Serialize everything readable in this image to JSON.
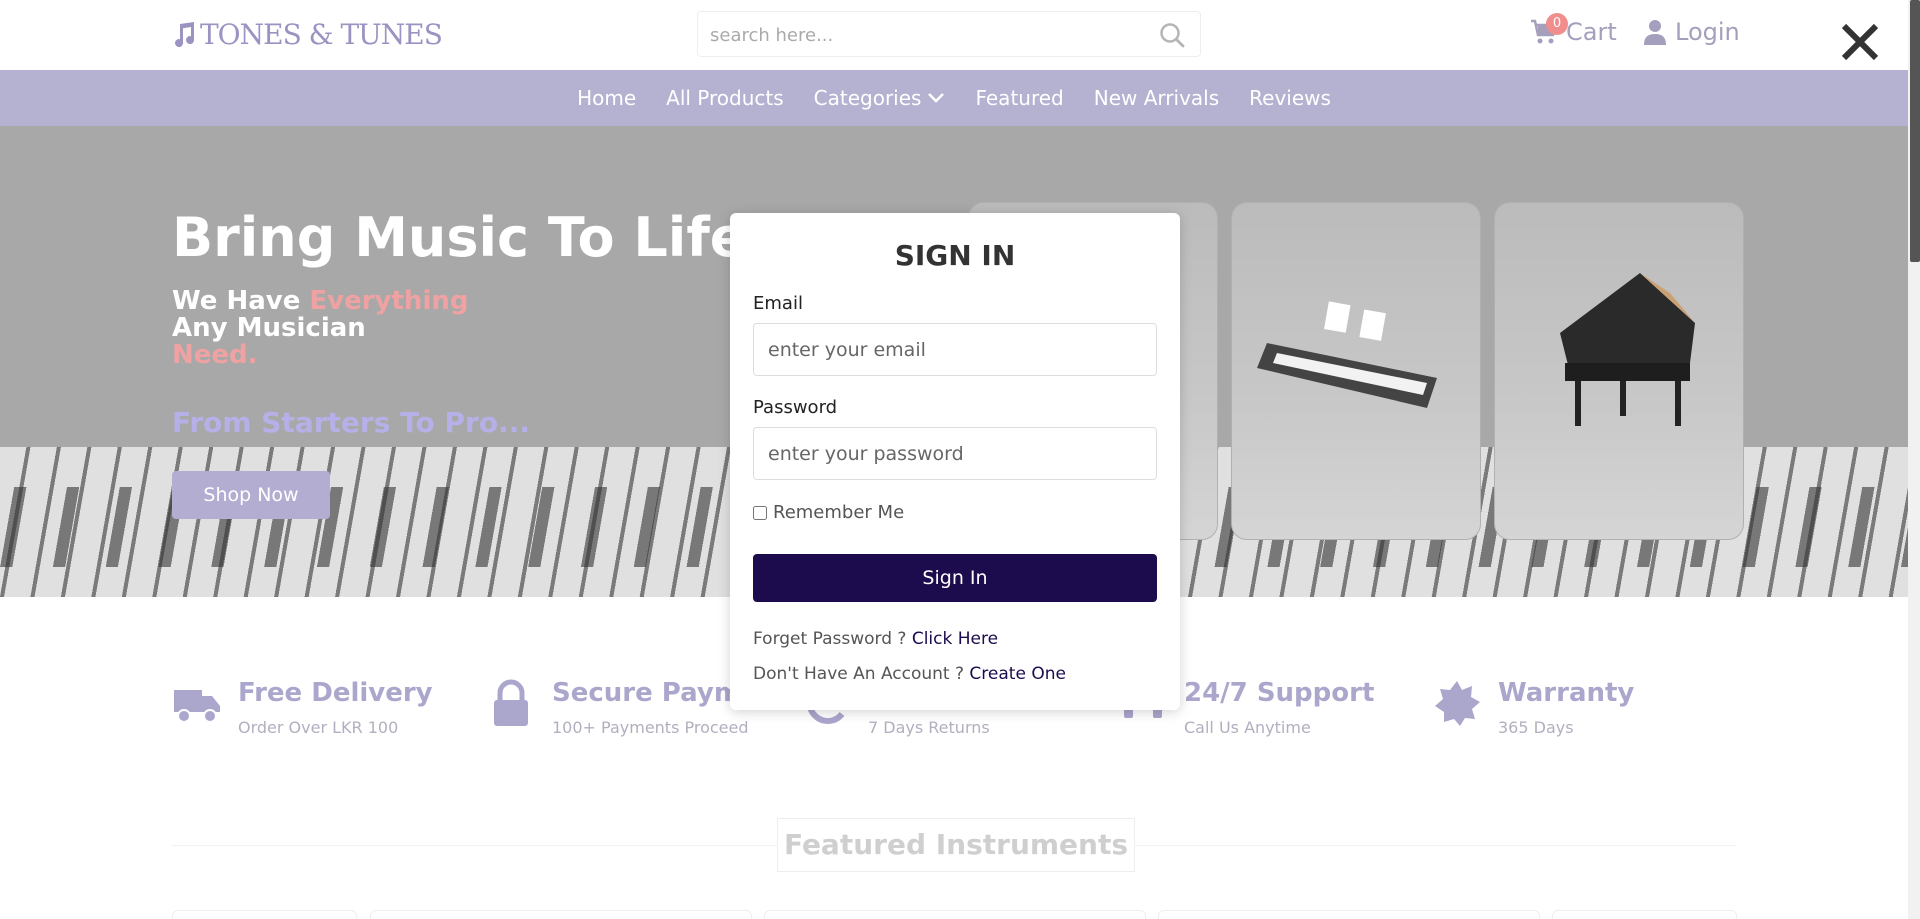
{
  "header": {
    "logo_text": "TONES & TUNES",
    "search_placeholder": "search here...",
    "cart_label": "Cart",
    "cart_count": "0",
    "login_label": "Login"
  },
  "nav": {
    "items": [
      {
        "label": "Home"
      },
      {
        "label": "All Products"
      },
      {
        "label": "Categories"
      },
      {
        "label": "Featured"
      },
      {
        "label": "New Arrivals"
      },
      {
        "label": "Reviews"
      }
    ]
  },
  "hero": {
    "title": "Bring Music To Life",
    "sub_1": "We Have ",
    "sub_highlight": "Everything",
    "sub_2": "Any Musician",
    "sub_3": "Need.",
    "tagline": "From Starters To Pro...",
    "shop_button": "Shop Now"
  },
  "features": [
    {
      "title": "Free Delivery",
      "sub": "Order Over LKR 100",
      "icon": "truck-icon"
    },
    {
      "title": "Secure Paymen",
      "sub": "100+ Payments Proceed",
      "icon": "lock-icon"
    },
    {
      "title": "",
      "sub": "7 Days Returns",
      "icon": "return-icon"
    },
    {
      "title": "24/7 Support",
      "sub": "Call Us Anytime",
      "icon": "headset-icon"
    },
    {
      "title": "Warranty",
      "sub": "365 Days",
      "icon": "badge-icon"
    }
  ],
  "featured_heading": "Featured Instruments",
  "modal": {
    "title": "SIGN IN",
    "email_label": "Email",
    "email_placeholder": "enter your email",
    "password_label": "Password",
    "password_placeholder": "enter your password",
    "remember_label": "Remember Me",
    "signin_button": "Sign In",
    "forgot_text": "Forget Password ?",
    "forgot_link": "Click Here",
    "no_account_text": "Don't Have An Account ?",
    "create_link": "Create One"
  },
  "colors": {
    "brand": "#9b93c2",
    "nav_bg": "#b4b1d1",
    "button_dark": "#1c0b4d",
    "accent_pink": "#f0a2a2"
  }
}
